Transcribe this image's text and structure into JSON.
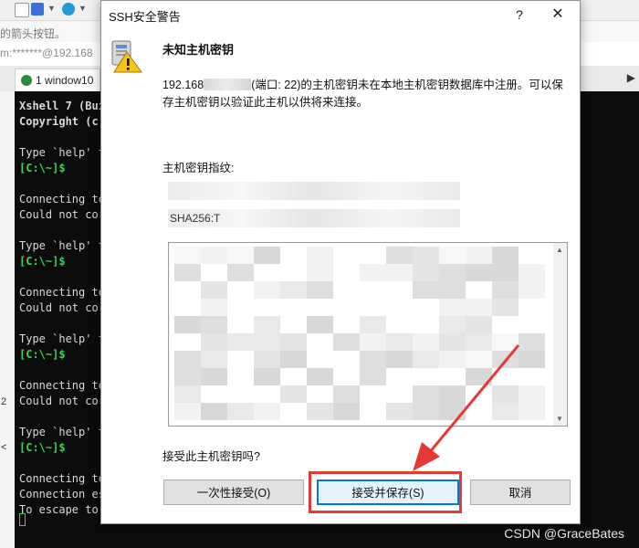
{
  "background": {
    "address_text": "m:*******@192.168",
    "hint_text": "的箭头按钮。",
    "session_tab": "1 window10",
    "tab_right_label": "▶",
    "left_strip_labels": [
      "2",
      "<"
    ],
    "terminal_lines": [
      {
        "text": "Xshell 7 (Bui",
        "style": "bold"
      },
      {
        "text": "Copyright (c)",
        "style": "bold"
      },
      {
        "text": "",
        "style": ""
      },
      {
        "text": "Type `help' t",
        "style": ""
      },
      {
        "text": "[C:\\~]$",
        "style": "prompt"
      },
      {
        "text": "",
        "style": ""
      },
      {
        "text": "Connecting to",
        "style": ""
      },
      {
        "text": "Could not cor",
        "style": ""
      },
      {
        "text": "",
        "style": ""
      },
      {
        "text": "Type `help' t",
        "style": ""
      },
      {
        "text": "[C:\\~]$",
        "style": "prompt"
      },
      {
        "text": "",
        "style": ""
      },
      {
        "text": "Connecting to",
        "style": ""
      },
      {
        "text": "Could not cor",
        "style": ""
      },
      {
        "text": "",
        "style": ""
      },
      {
        "text": "Type `help' t",
        "style": ""
      },
      {
        "text": "[C:\\~]$",
        "style": "prompt"
      },
      {
        "text": "",
        "style": ""
      },
      {
        "text": "Connecting to",
        "style": ""
      },
      {
        "text": "Could not cor",
        "style": ""
      },
      {
        "text": "",
        "style": ""
      },
      {
        "text": "Type `help' t",
        "style": ""
      },
      {
        "text": "[C:\\~]$",
        "style": "prompt"
      },
      {
        "text": "",
        "style": ""
      },
      {
        "text": "Connecting to",
        "style": ""
      },
      {
        "text": "Connection es",
        "style": ""
      },
      {
        "text": "To escape to",
        "style": ""
      }
    ],
    "watermark": "CSDN @GraceBates"
  },
  "dialog": {
    "title": "SSH安全警告",
    "help_label": "?",
    "close_label": "✕",
    "icon": "security-warning-icon",
    "heading": "未知主机密钥",
    "message_prefix": "192.168",
    "message_rest": "(端口: 22)的主机密钥未在本地主机密钥数据库中注册。可以保存主机密钥以验证此主机以供将来连接。",
    "fingerprint_label": "主机密钥指纹:",
    "fingerprint_lines": [
      "",
      "SHA256:T"
    ],
    "accept_question": "接受此主机密钥吗?",
    "buttons": {
      "accept_once": "一次性接受(O)",
      "accept_and_save": "接受并保存(S)",
      "cancel": "取消"
    }
  },
  "colors": {
    "terminal_bg": "#0c0c0c",
    "prompt_green": "#39d353",
    "focus_blue": "#0078d7",
    "annotation_red": "#e53935"
  }
}
